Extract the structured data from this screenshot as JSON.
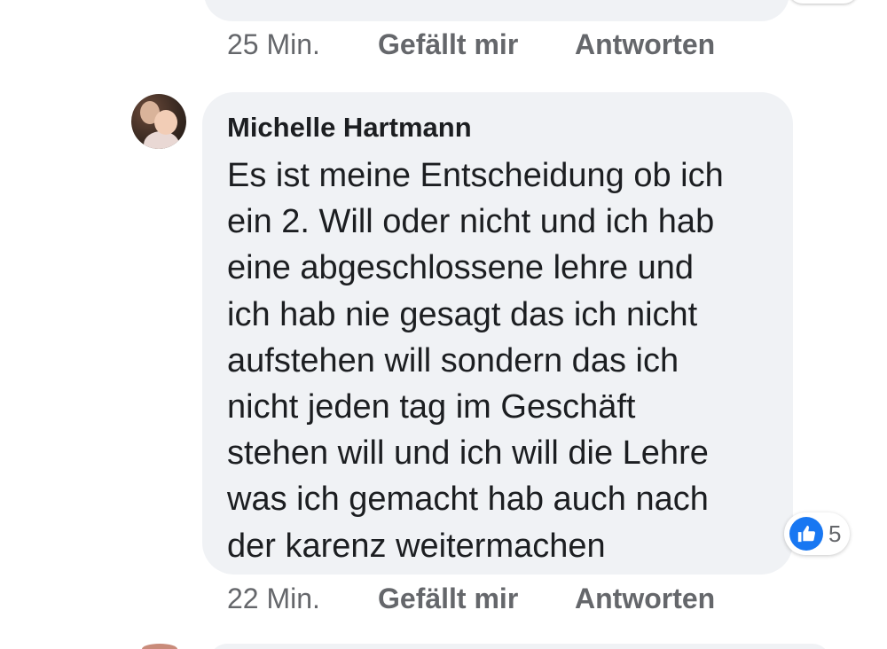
{
  "previous_comment": {
    "time": "25 Min.",
    "like_label": "Gefällt mir",
    "reply_label": "Antworten"
  },
  "comment": {
    "author": "Michelle Hartmann",
    "lines": [
      "Es ist meine Entscheidung ob ich",
      "ein 2. Will oder nicht und ich hab",
      "eine abgeschlossene lehre und",
      "ich hab nie gesagt das ich nicht",
      "aufstehen will sondern das ich",
      "nicht jeden tag im Geschäft",
      "stehen will und ich will die Lehre",
      "was ich gemacht hab auch nach",
      "der karenz weitermachen"
    ],
    "reaction": {
      "icon": "thumbs-up-icon",
      "count": "5",
      "color": "#1877f2"
    },
    "time": "22 Min.",
    "like_label": "Gefällt mir",
    "reply_label": "Antworten"
  },
  "colors": {
    "bubble": "#f0f2f5",
    "text": "#1c1e21",
    "meta": "#65676b"
  }
}
